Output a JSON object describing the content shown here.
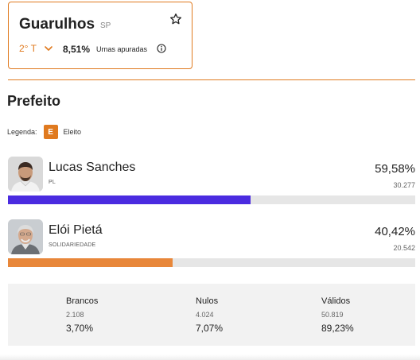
{
  "location": {
    "city": "Guarulhos",
    "state": "SP",
    "round": "2° T",
    "urnas_percent": "8,51%",
    "urnas_label": "Urnas apuradas",
    "favorite_icon": "star-icon",
    "info_icon": "info-icon"
  },
  "section_title": "Prefeito",
  "legend": {
    "label": "Legenda:",
    "badge": "E",
    "text": "Eleito"
  },
  "candidates": [
    {
      "name": "Lucas Sanches",
      "party": "PL",
      "percent": "59,58%",
      "votes": "30.277",
      "share": 0.5958,
      "color": "#4a2be0"
    },
    {
      "name": "Elói Pietá",
      "party": "SOLIDARIEDADE",
      "percent": "40,42%",
      "votes": "20.542",
      "share": 0.4042,
      "color": "#e8873a"
    }
  ],
  "summary": [
    {
      "label": "Brancos",
      "count": "2.108",
      "percent": "3,70%"
    },
    {
      "label": "Nulos",
      "count": "4.024",
      "percent": "7,07%"
    },
    {
      "label": "Válidos",
      "count": "50.819",
      "percent": "89,23%"
    }
  ],
  "colors": {
    "accent": "#e07a1f"
  }
}
